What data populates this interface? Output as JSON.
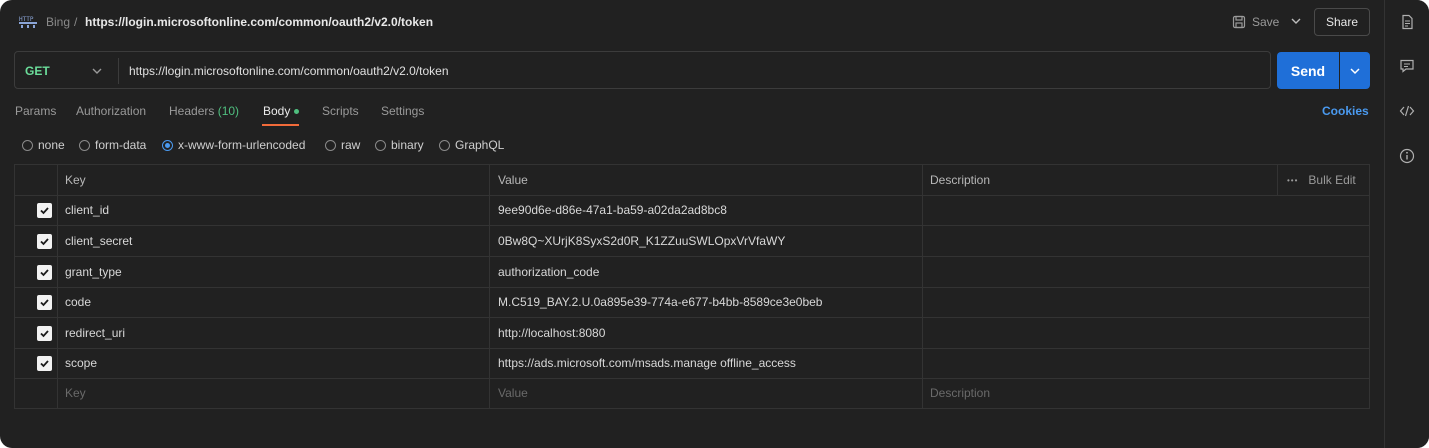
{
  "header": {
    "breadcrumb_parent": "Bing",
    "breadcrumb_sep": "/",
    "title": "https://login.microsoftonline.com/common/oauth2/v2.0/token",
    "save_label": "Save",
    "share_label": "Share"
  },
  "request": {
    "method": "GET",
    "url": "https://login.microsoftonline.com/common/oauth2/v2.0/token",
    "send_label": "Send"
  },
  "tabs": {
    "params": "Params",
    "authorization": "Authorization",
    "headers": "Headers",
    "headers_count": "(10)",
    "body": "Body",
    "scripts": "Scripts",
    "settings": "Settings",
    "cookies": "Cookies"
  },
  "body_types": {
    "none": "none",
    "form_data": "form-data",
    "urlencoded": "x-www-form-urlencoded",
    "raw": "raw",
    "binary": "binary",
    "graphql": "GraphQL",
    "selected": "x-www-form-urlencoded"
  },
  "table": {
    "columns": {
      "key": "Key",
      "value": "Value",
      "description": "Description"
    },
    "bulk_edit": "Bulk Edit",
    "more": "•••",
    "rows": [
      {
        "key": "client_id",
        "value": "9ee90d6e-d86e-47a1-ba59-a02da2ad8bc8",
        "description": "",
        "checked": true
      },
      {
        "key": "client_secret",
        "value": "0Bw8Q~XUrjK8SyxS2d0R_K1ZZuuSWLOpxVrVfaWY",
        "description": "",
        "checked": true
      },
      {
        "key": "grant_type",
        "value": "authorization_code",
        "description": "",
        "checked": true
      },
      {
        "key": "code",
        "value": "M.C519_BAY.2.U.0a895e39-774a-e677-b4bb-8589ce3e0beb",
        "description": "",
        "checked": true
      },
      {
        "key": "redirect_uri",
        "value": "http://localhost:8080",
        "description": "",
        "checked": true
      },
      {
        "key": "scope",
        "value": "https://ads.microsoft.com/msads.manage offline_access",
        "description": "",
        "checked": true
      }
    ],
    "placeholder": {
      "key": "Key",
      "value": "Value",
      "description": "Description"
    }
  },
  "icons": {
    "http": "http-icon",
    "save": "save-icon",
    "documentation": "document-icon",
    "comments": "comment-icon",
    "code": "code-icon",
    "info": "info-icon"
  },
  "colors": {
    "background": "#212121",
    "method_get": "#6bdd9a",
    "send": "#1f6fd8",
    "active_tab_underline": "#f26b3a",
    "link": "#4a9af0"
  }
}
